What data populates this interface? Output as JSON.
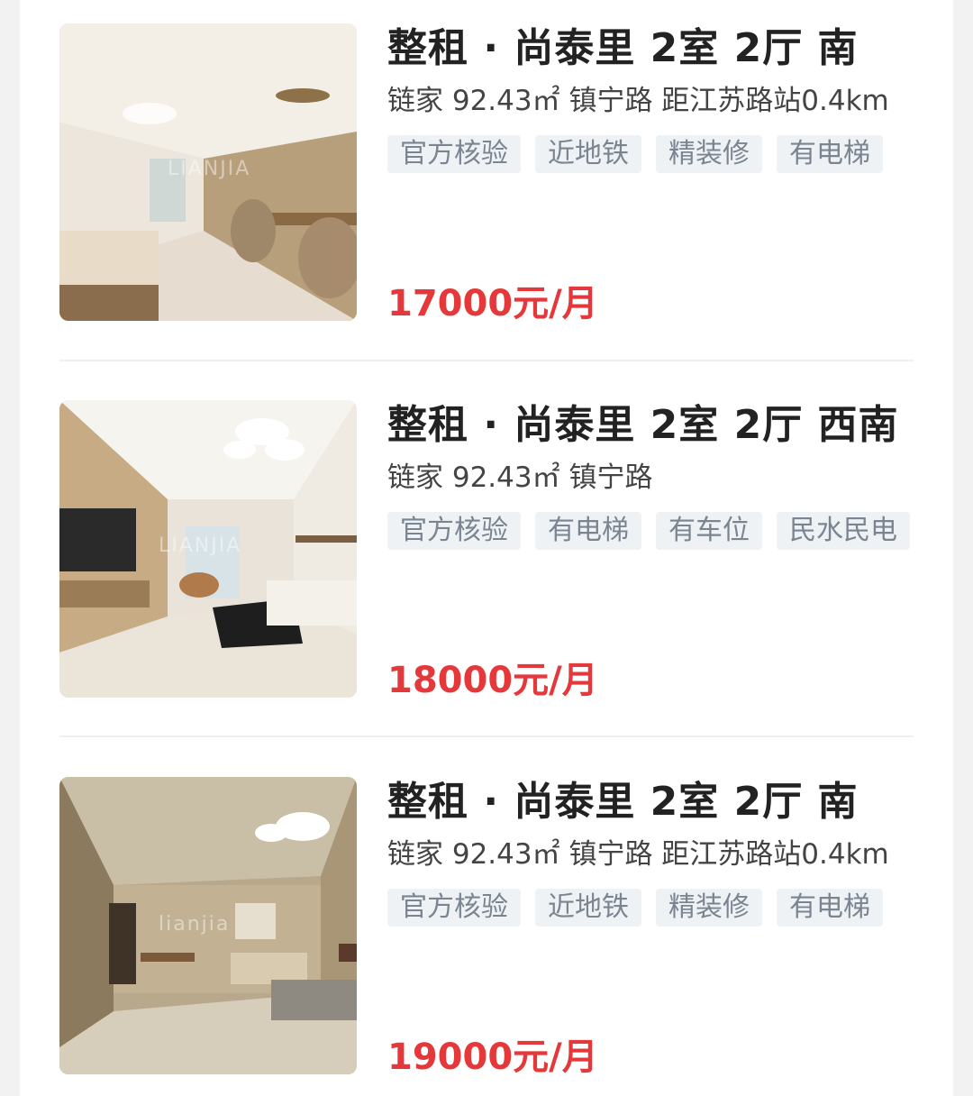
{
  "listings": [
    {
      "title": "整租 · 尚泰里 2室 2厅 南",
      "meta": "链家 92.43㎡ 镇宁路 距江苏路站0.4km",
      "tags": [
        "官方核验",
        "近地铁",
        "精装修",
        "有电梯"
      ],
      "price": "17000元/月",
      "photo_icon": "living-room-photo"
    },
    {
      "title": "整租 · 尚泰里 2室 2厅 西南",
      "meta": "链家 92.43㎡ 镇宁路",
      "tags": [
        "官方核验",
        "有电梯",
        "有车位",
        "民水民电"
      ],
      "price": "18000元/月",
      "photo_icon": "living-room-photo",
      "watermark": "LIANJIA"
    },
    {
      "title": "整租 · 尚泰里 2室 2厅 南",
      "meta": "链家 92.43㎡ 镇宁路 距江苏路站0.4km",
      "tags": [
        "官方核验",
        "近地铁",
        "精装修",
        "有电梯"
      ],
      "price": "19000元/月",
      "photo_icon": "living-room-photo",
      "watermark": "lianjia"
    }
  ],
  "colors": {
    "price": "#e5383b",
    "tag_bg": "#eef2f5",
    "tag_text": "#7b8591",
    "title": "#222222"
  }
}
